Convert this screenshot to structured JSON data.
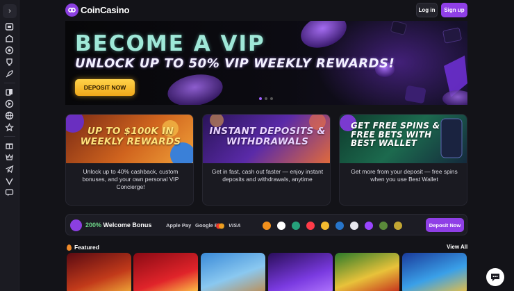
{
  "header": {
    "logo_text": "CoinCasino",
    "login_label": "Log in",
    "signup_label": "Sign up"
  },
  "sidebar": {
    "items": [
      "home-icon",
      "casino-icon",
      "live-icon",
      "sports-icon",
      "rocket-icon",
      "cards-icon",
      "play-icon",
      "globe-icon",
      "star-icon",
      "gift-icon",
      "telegram-icon",
      "vip-icon",
      "chat-icon"
    ]
  },
  "hero": {
    "title": "BECOME A VIP",
    "subtitle": "UNLOCK UP TO 50% VIP WEEKLY REWARDS!",
    "cta_label": "DEPOSIT NOW",
    "slides": 3,
    "active_slide": 1
  },
  "promos": [
    {
      "headline": "UP TO $100K IN WEEKLY REWARDS",
      "description": "Unlock up to 40% cashback, custom bonuses, and your own personal VIP Concierge!",
      "accent": "#f5b13a"
    },
    {
      "headline": "INSTANT DEPOSITS & WITHDRAWALS",
      "description": "Get in fast, cash out faster — enjoy instant deposits and withdrawals, anytime",
      "accent": "#b56cff"
    },
    {
      "headline": "GET FREE SPINS & FREE BETS WITH BEST WALLET",
      "description": "Get more from your deposit — free spins when you use Best Wallet",
      "accent": "#49d6a0"
    }
  ],
  "welcome": {
    "bonus_pct": "200%",
    "bonus_label": "Welcome Bonus",
    "payments": [
      "Apple Pay",
      "Google Pay",
      "Mastercard",
      "VISA"
    ],
    "coins": [
      "bitcoin-icon",
      "ethereum-icon",
      "tether-icon",
      "tron-icon",
      "bnb-icon",
      "usdc-icon",
      "ripple-icon",
      "solana-icon",
      "litecoin-icon",
      "dogecoin-icon"
    ],
    "deposit_label": "Deposit Now"
  },
  "featured": {
    "title": "Featured",
    "view_all": "View All",
    "games": [
      "game-1",
      "game-2",
      "game-3",
      "game-4",
      "game-5",
      "game-6"
    ]
  },
  "colors": {
    "accent": "#8f3fe6",
    "background": "#131318",
    "cta_gold": "#f5b82a"
  }
}
